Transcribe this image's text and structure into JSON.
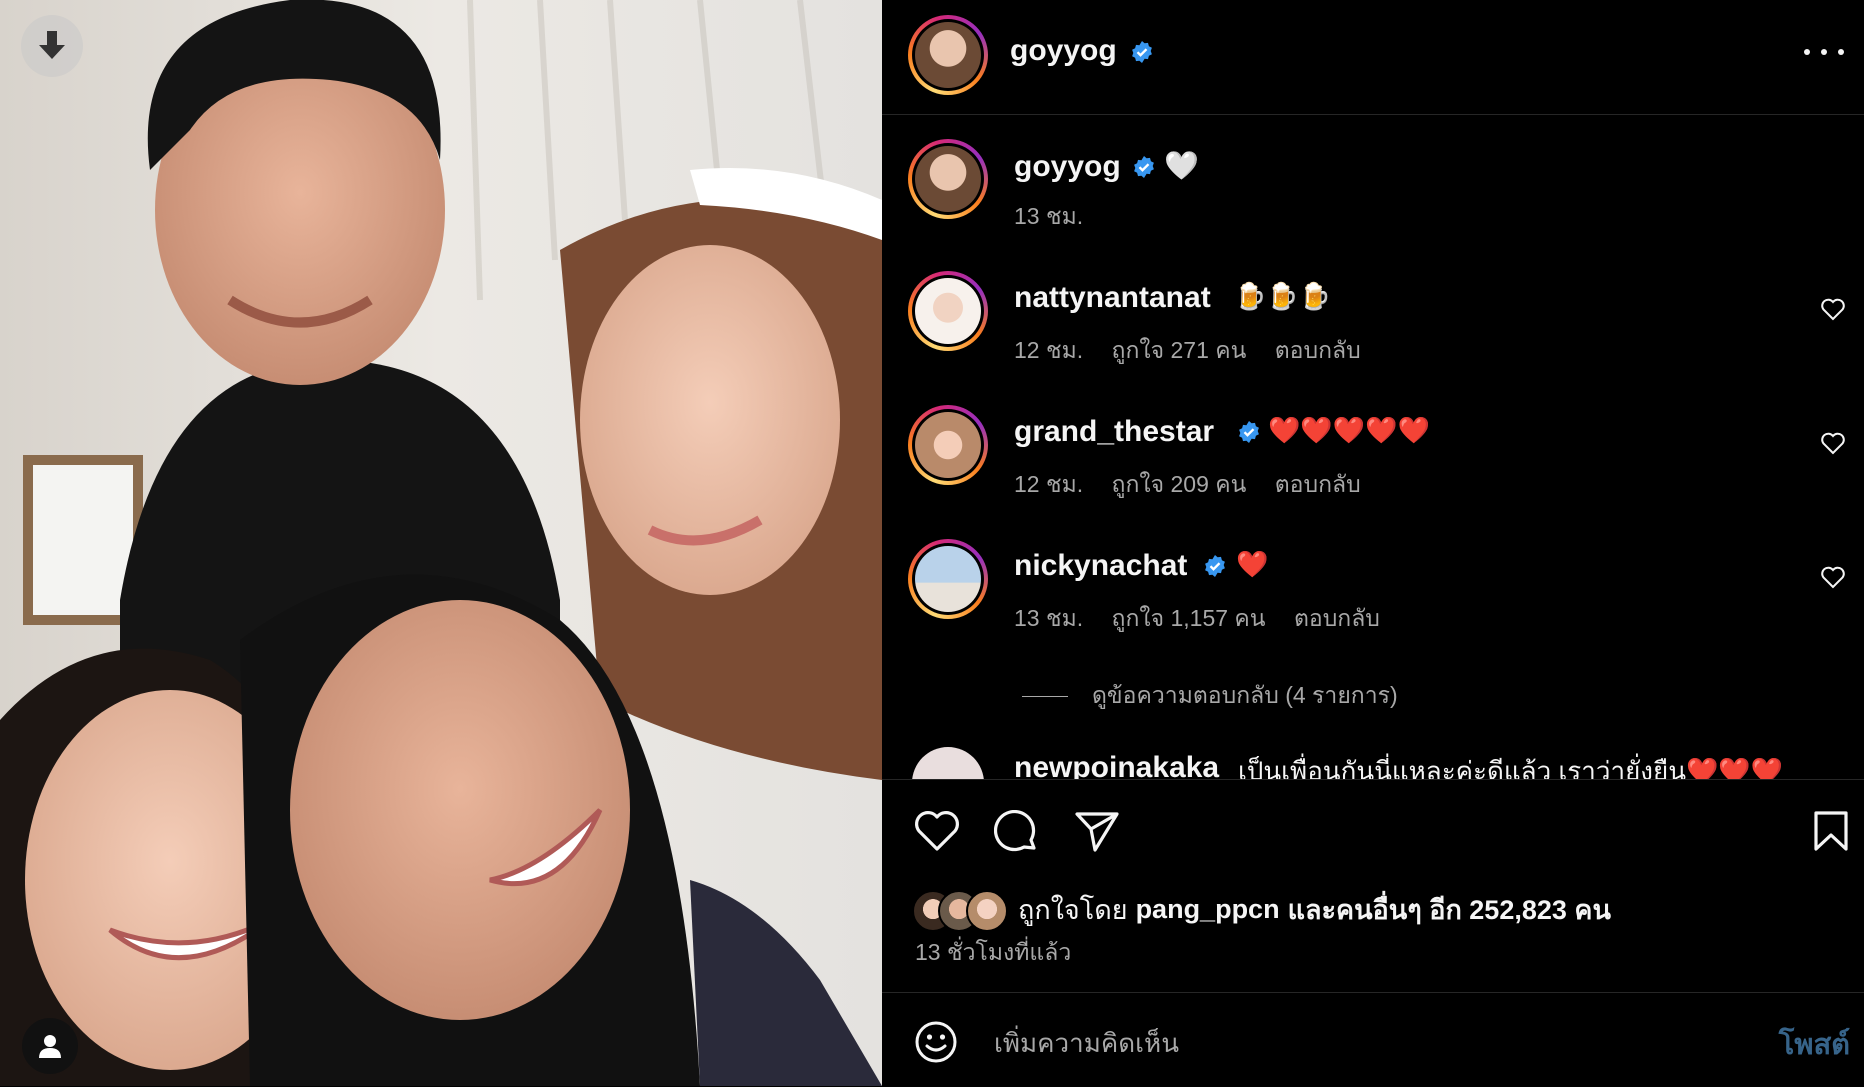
{
  "post": {
    "author": "goyyog",
    "caption_emoji": "🤍",
    "caption_time": "13 ชม."
  },
  "comments": [
    {
      "username": "nattynantanat",
      "verified": false,
      "text": "🍺🍺🍺",
      "time": "12 ชม.",
      "likes": "ถูกใจ 271 คน",
      "reply": "ตอบกลับ"
    },
    {
      "username": "grand_thestar",
      "verified": true,
      "text": "❤️❤️❤️❤️❤️",
      "time": "12 ชม.",
      "likes": "ถูกใจ 209 คน",
      "reply": "ตอบกลับ"
    },
    {
      "username": "nickynachat",
      "verified": true,
      "text": "❤️",
      "time": "13 ชม.",
      "likes": "ถูกใจ 1,157 คน",
      "reply": "ตอบกลับ"
    },
    {
      "username": "newpoinakaka",
      "verified": false,
      "text": "เป็นเพื่อนกันนี่แหละค่ะดีแล้ว เราว่ายั่งยืน❤️❤️❤️",
      "time": "",
      "likes": "",
      "reply": ""
    }
  ],
  "view_replies": "ดูข้อความตอบกลับ (4 รายการ)",
  "liked_by": {
    "prefix": "ถูกใจโดย",
    "user": "pang_ppcn",
    "suffix": "และคนอื่นๆ อีก 252,823 คน"
  },
  "posted_ago": "13 ชั่วโมงที่แล้ว",
  "add_comment_placeholder": "เพิ่มความคิดเห็น",
  "post_button": "โพสต์",
  "colors": {
    "background": "#000000",
    "verified": "#3897f0",
    "secondary_text": "#a8a8a8",
    "post_button": "#37648a"
  }
}
